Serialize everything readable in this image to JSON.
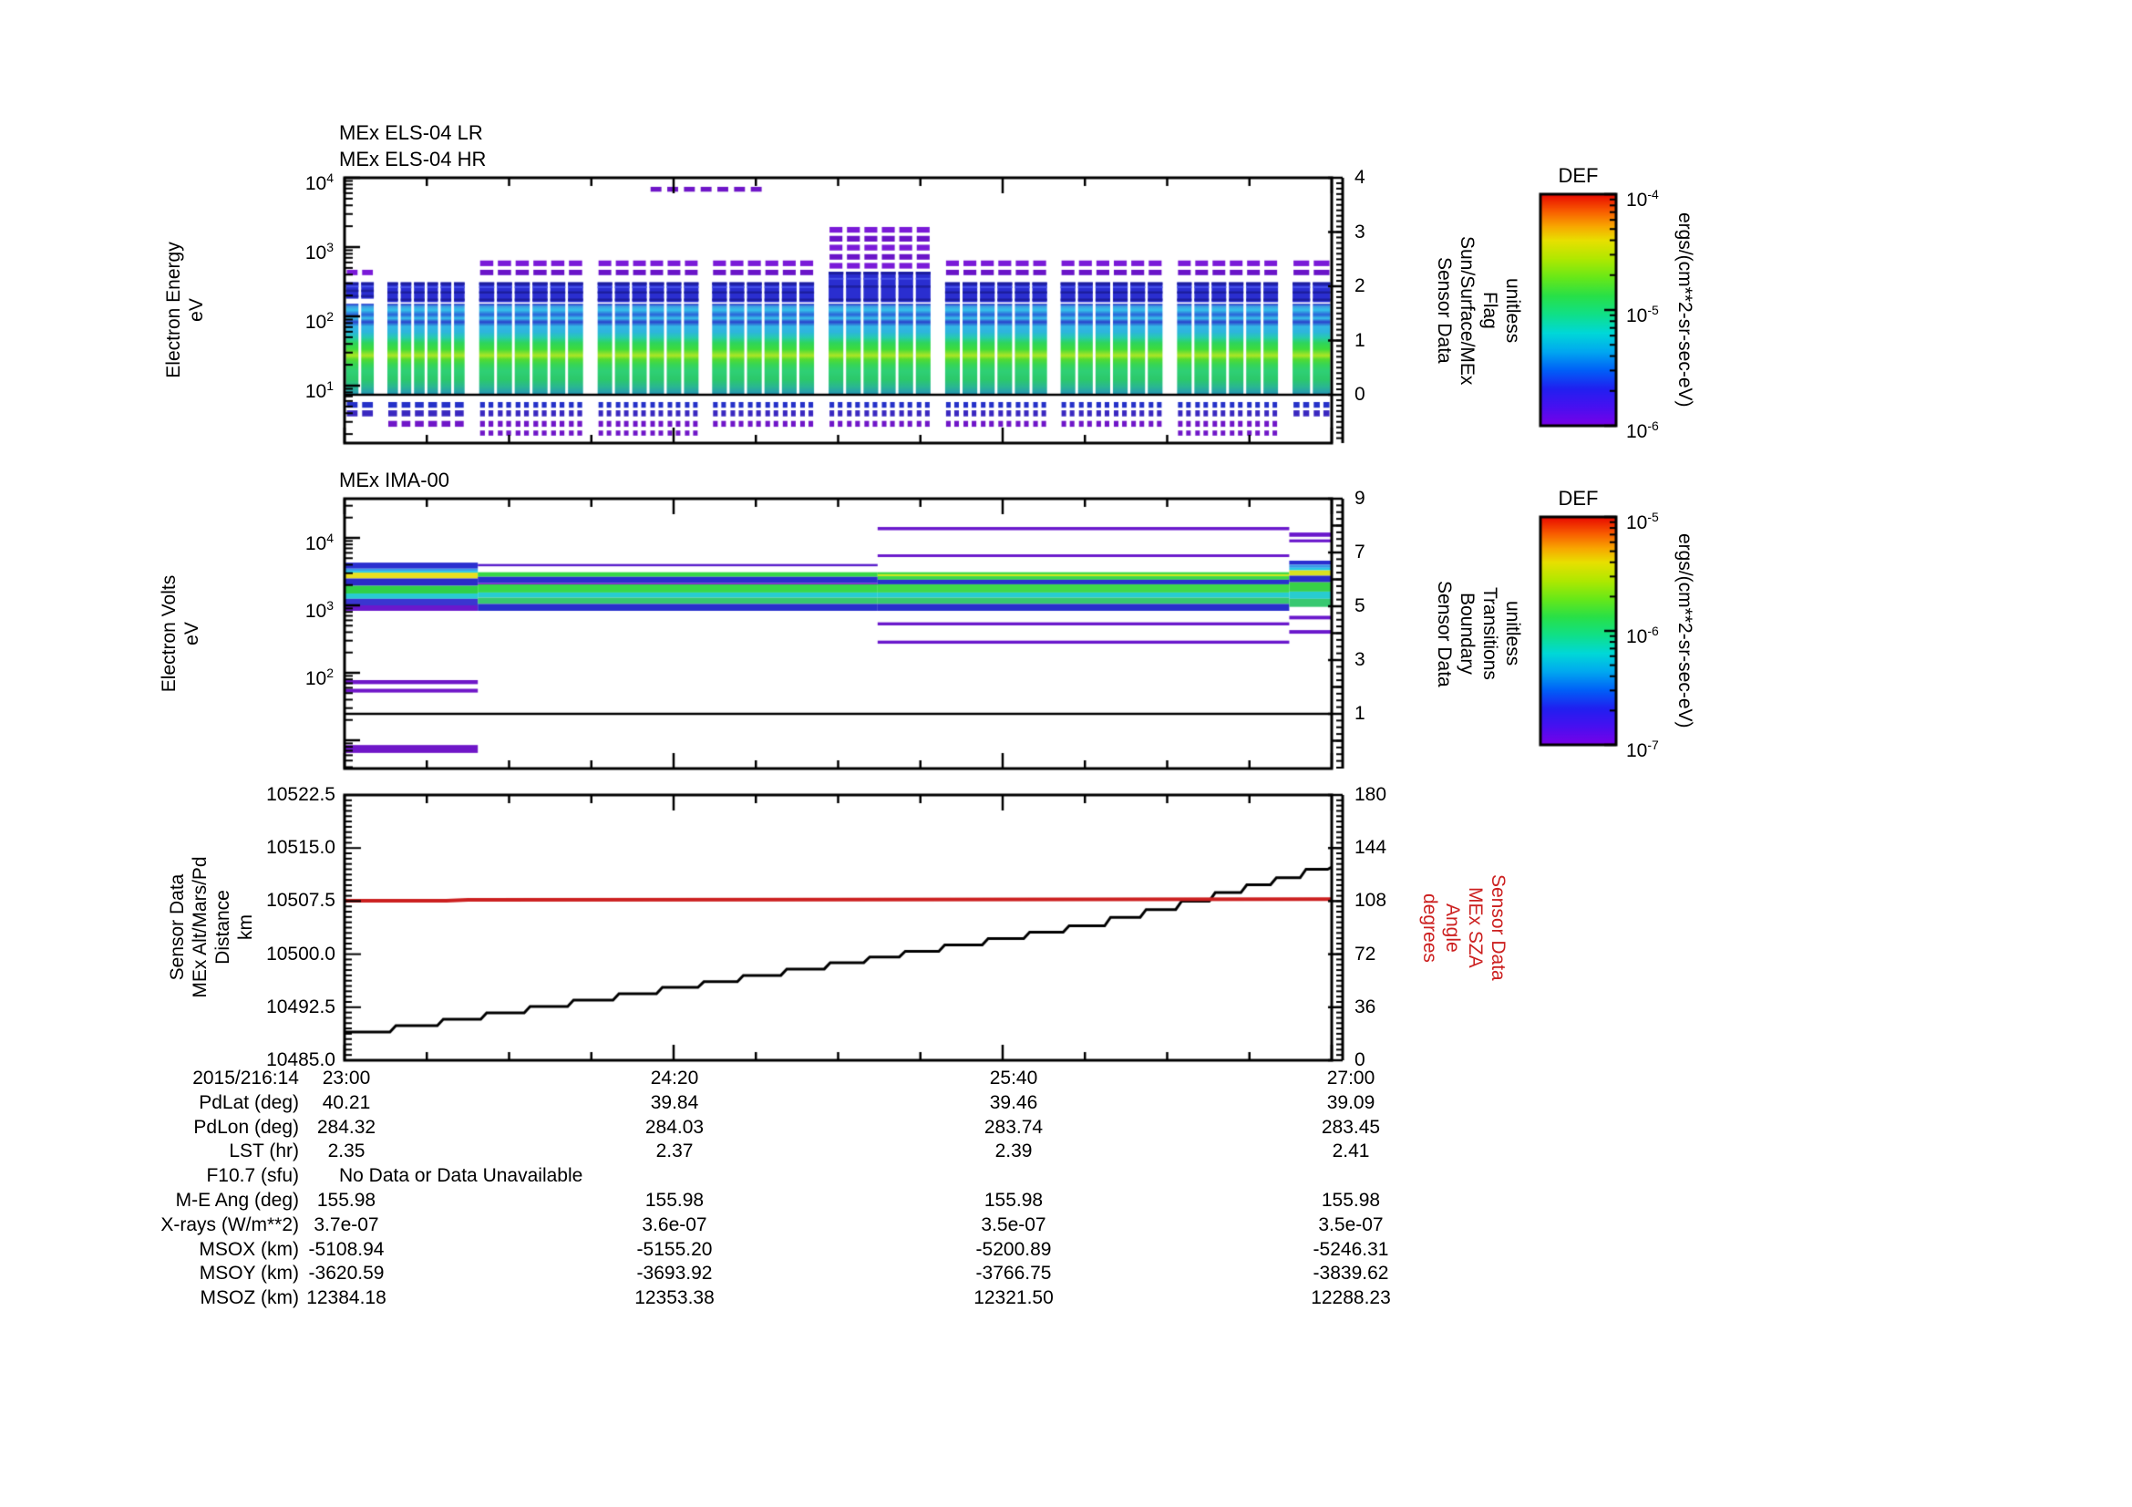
{
  "els_panel": {
    "titles": [
      "MEx ELS-04 LR",
      "MEx ELS-04 HR"
    ],
    "ylabel_lines": [
      "Electron Energy",
      "eV"
    ],
    "ytick_exponents": [
      4,
      3,
      2,
      1
    ],
    "right_label_lines": [
      "Sensor Data",
      "Sun/Surface/MEx",
      "Flag",
      "unitless"
    ],
    "right_ticks": [
      4,
      3,
      2,
      1,
      0
    ]
  },
  "ima_panel": {
    "title": "MEx IMA-00",
    "ylabel_lines": [
      "Electron Volts",
      "eV"
    ],
    "ytick_exponents": [
      4,
      3,
      2
    ],
    "right_label_lines": [
      "Sensor Data",
      "Boundary",
      "Transitions",
      "unitless"
    ],
    "right_ticks": [
      9,
      7,
      5,
      3,
      1
    ]
  },
  "xy_panel": {
    "ylabel_lines": [
      "Sensor Data",
      "MEx Alt/Mars/Pd",
      "Distance",
      "km"
    ],
    "yticks": [
      "10522.5",
      "10515.0",
      "10507.5",
      "10500.0",
      "10492.5",
      "10485.0"
    ],
    "right_label_lines": [
      "Sensor Data",
      "MEx SZA",
      "Angle",
      "degrees"
    ],
    "right_ticks": [
      180,
      144,
      108,
      72,
      36,
      0
    ],
    "xticks": [
      "23:00",
      "24:20",
      "25:40",
      "27:00"
    ],
    "sza_color": "#cc2020",
    "distance_color": "#000000"
  },
  "colorbars": [
    {
      "title": "DEF",
      "tick_exponents": [
        -4,
        -5,
        -6
      ],
      "unit": "ergs/(cm**2-sr-sec-eV)"
    },
    {
      "title": "DEF",
      "tick_exponents": [
        -5,
        -6,
        -7
      ],
      "unit": "ergs/(cm**2-sr-sec-eV)"
    }
  ],
  "table": {
    "date_label": "2015/216:14",
    "row_labels": [
      "PdLat (deg)",
      "PdLon (deg)",
      "LST (hr)",
      "F10.7 (sfu)",
      "M-E Ang (deg)",
      "X-rays (W/m**2)",
      "MSOX (km)",
      "MSOY (km)",
      "MSOZ (km)"
    ],
    "no_data_text": "No Data or Data Unavailable",
    "columns": [
      {
        "time": "23:00",
        "values": [
          "40.21",
          "284.32",
          "2.35",
          "",
          "155.98",
          "3.7e-07",
          "-5108.94",
          "-3620.59",
          "12384.18"
        ]
      },
      {
        "time": "24:20",
        "values": [
          "39.84",
          "284.03",
          "2.37",
          "",
          "155.98",
          "3.6e-07",
          "-5155.20",
          "-3693.92",
          "12353.38"
        ]
      },
      {
        "time": "25:40",
        "values": [
          "39.46",
          "283.74",
          "2.39",
          "",
          "155.98",
          "3.5e-07",
          "-5200.89",
          "-3766.75",
          "12321.50"
        ]
      },
      {
        "time": "27:00",
        "values": [
          "39.09",
          "283.45",
          "2.41",
          "",
          "155.98",
          "3.5e-07",
          "-5246.31",
          "-3839.62",
          "12288.23"
        ]
      }
    ]
  },
  "chart_data": [
    {
      "id": "els",
      "type": "heatmap",
      "title": "MEx ELS-04 LR / MEx ELS-04 HR",
      "x_range": [
        "23:00",
        "27:00"
      ],
      "y_range_ev": [
        1.5,
        10000
      ],
      "value_range": [
        "1e-6",
        "1e-4"
      ],
      "flag_line_value": 0,
      "band_energy_ev": [
        152,
        7.4
      ],
      "band_gradient": [
        [
          0.0,
          "#2433c8"
        ],
        [
          0.03,
          "#3f9fe3"
        ],
        [
          0.07,
          "#35c3ea"
        ],
        [
          0.12,
          "#2a62d8"
        ],
        [
          0.16,
          "#38c3ea"
        ],
        [
          0.2,
          "#2a42cc"
        ],
        [
          0.25,
          "#34b8e6"
        ],
        [
          0.31,
          "#2db4dd"
        ],
        [
          0.37,
          "#27cbb0"
        ],
        [
          0.43,
          "#2ed55e"
        ],
        [
          0.5,
          "#3fdc3a"
        ],
        [
          0.57,
          "#aee625"
        ],
        [
          0.61,
          "#55dc30"
        ],
        [
          0.67,
          "#36d556"
        ],
        [
          0.74,
          "#2fd076"
        ],
        [
          0.83,
          "#2cc96a"
        ],
        [
          0.91,
          "#2ab890"
        ],
        [
          1.0,
          "#2796b8"
        ]
      ],
      "below_line_rows": [
        [
          5.8,
          4.8,
          "#2531c8"
        ],
        [
          4.4,
          3.6,
          "#3a28c0"
        ],
        [
          3.1,
          2.55,
          "#6f16c8"
        ],
        [
          2.25,
          1.9,
          "#6f16c8"
        ]
      ],
      "high_dash": {
        "x0": 0.31,
        "x1": 0.42,
        "e_hi": 7400,
        "e_lo": 6300,
        "color": "#6f16c8"
      },
      "colors": {
        "purple": "#7a1ad8",
        "blue_block": "#2a2ed0",
        "blue_dark": "#1d1fa0",
        "blue_lite": "#4550e8"
      },
      "groups": [
        {
          "x0": 0.0,
          "x1": 0.031,
          "cols": 2,
          "purple": [
            [
              470,
              370
            ]
          ],
          "blue": [
            310,
            180
          ],
          "band": true,
          "below": 2
        },
        {
          "x0": 0.042,
          "x1": 0.123,
          "cols": 6,
          "purple": [],
          "blue": [
            310,
            160
          ],
          "band": true,
          "below": 3
        },
        {
          "x0": 0.135,
          "x1": 0.243,
          "cols": 6,
          "purple": [
            [
              640,
              500
            ],
            [
              470,
              370
            ]
          ],
          "blue": [
            310,
            160
          ],
          "band": true,
          "below": 4
        },
        {
          "x0": 0.255,
          "x1": 0.36,
          "cols": 6,
          "purple": [
            [
              640,
              500
            ],
            [
              470,
              370
            ]
          ],
          "blue": [
            310,
            160
          ],
          "band": true,
          "below": 4
        },
        {
          "x0": 0.371,
          "x1": 0.477,
          "cols": 6,
          "purple": [
            [
              640,
              500
            ],
            [
              470,
              370
            ]
          ],
          "blue": [
            310,
            160
          ],
          "band": true,
          "below": 3
        },
        {
          "x0": 0.489,
          "x1": 0.595,
          "cols": 6,
          "purple": [
            [
              1950,
              1520
            ],
            [
              1450,
              1130
            ],
            [
              1080,
              840
            ],
            [
              790,
              620
            ],
            [
              590,
              460
            ]
          ],
          "blue": [
            440,
            160
          ],
          "band": true,
          "below": 3
        },
        {
          "x0": 0.607,
          "x1": 0.713,
          "cols": 6,
          "purple": [
            [
              640,
              500
            ],
            [
              470,
              370
            ]
          ],
          "blue": [
            310,
            160
          ],
          "band": true,
          "below": 3
        },
        {
          "x0": 0.724,
          "x1": 0.83,
          "cols": 6,
          "purple": [
            [
              640,
              500
            ],
            [
              470,
              370
            ]
          ],
          "blue": [
            310,
            160
          ],
          "band": true,
          "below": 3
        },
        {
          "x0": 0.842,
          "x1": 0.947,
          "cols": 6,
          "purple": [
            [
              640,
              500
            ],
            [
              470,
              370
            ]
          ],
          "blue": [
            310,
            160
          ],
          "band": true,
          "below": 4
        },
        {
          "x0": 0.959,
          "x1": 1.0,
          "cols": 2,
          "purple": [
            [
              640,
              500
            ],
            [
              470,
              370
            ]
          ],
          "blue": [
            310,
            160
          ],
          "band": true,
          "below": 2
        }
      ]
    },
    {
      "id": "ima",
      "type": "heatmap",
      "title": "MEx IMA-00",
      "x_range": [
        "23:00",
        "27:00"
      ],
      "y_range_ev": [
        4,
        38000
      ],
      "value_range": [
        "1e-7",
        "1e-5"
      ],
      "boundary_line_value": 1,
      "segments": [
        {
          "x0": 0.0,
          "x1": 0.135,
          "bands": [
            [
              4300,
              3500,
              "#2b2fd0"
            ],
            [
              3500,
              3250,
              "#3a9ae8"
            ],
            [
              3250,
              3050,
              "#28c8e8"
            ],
            [
              3050,
              2500,
              "#e8e020"
            ],
            [
              2500,
              1950,
              "#2b2bc8"
            ],
            [
              1950,
              1500,
              "#30d048"
            ],
            [
              1500,
              1250,
              "#28ccd0"
            ],
            [
              1250,
              1000,
              "#3a35d0"
            ],
            [
              1000,
              830,
              "#6a18cc"
            ],
            [
              78,
              68,
              "#6f16c8"
            ],
            [
              58,
              51,
              "#6f16c8"
            ],
            [
              8.5,
              6.5,
              "#6f16c8"
            ]
          ]
        },
        {
          "x0": 0.135,
          "x1": 0.54,
          "bands": [
            [
              4100,
              3850,
              "#5a20cc"
            ],
            [
              3100,
              2650,
              "#38d848"
            ],
            [
              2650,
              2150,
              "#2830cc"
            ],
            [
              2150,
              2040,
              "#7020cc"
            ],
            [
              2040,
              1550,
              "#38d848"
            ],
            [
              1550,
              1300,
              "#28ccd0"
            ],
            [
              1300,
              1050,
              "#38c870"
            ],
            [
              1050,
              830,
              "#2830cc"
            ]
          ]
        },
        {
          "x0": 0.54,
          "x1": 0.957,
          "bands": [
            [
              14500,
              13000,
              "#6a18cc"
            ],
            [
              5700,
              5200,
              "#6a18cc"
            ],
            [
              3100,
              2900,
              "#38d848"
            ],
            [
              2900,
              2700,
              "#c8e822"
            ],
            [
              2700,
              2400,
              "#38d848"
            ],
            [
              2400,
              2050,
              "#2830cc"
            ],
            [
              2050,
              1550,
              "#40d848"
            ],
            [
              1550,
              1300,
              "#28ccd0"
            ],
            [
              1300,
              1050,
              "#38c870"
            ],
            [
              1050,
              830,
              "#2830cc"
            ],
            [
              560,
              505,
              "#6a18cc"
            ],
            [
              300,
              270,
              "#6a18cc"
            ]
          ]
        },
        {
          "x0": 0.957,
          "x1": 1.0,
          "bands": [
            [
              12000,
              10400,
              "#6a18cc"
            ],
            [
              9500,
              8600,
              "#6a18cc"
            ],
            [
              4600,
              4000,
              "#2b2fd0"
            ],
            [
              4000,
              3600,
              "#3a9ae8"
            ],
            [
              3600,
              3300,
              "#28c8e8"
            ],
            [
              3300,
              2750,
              "#d8e020"
            ],
            [
              2750,
              2200,
              "#2b2bc8"
            ],
            [
              2200,
              1600,
              "#38d048"
            ],
            [
              1600,
              1250,
              "#28ccd0"
            ],
            [
              1250,
              950,
              "#38c870"
            ],
            [
              700,
              620,
              "#6a18cc"
            ],
            [
              430,
              380,
              "#6a18cc"
            ]
          ]
        }
      ]
    },
    {
      "id": "xy",
      "type": "line",
      "x_tick_labels": [
        "23:00",
        "24:20",
        "25:40",
        "27:00"
      ],
      "ylim_left_km": [
        10485.0,
        10522.5
      ],
      "ylim_right_deg": [
        0,
        180
      ],
      "series": [
        {
          "name": "MEx Alt/Mars/Pd Distance (km)",
          "color": "#000000",
          "axis": "left",
          "points": [
            [
              0.0,
              10489.0
            ],
            [
              0.046,
              10489.0
            ],
            [
              0.052,
              10489.9
            ],
            [
              0.094,
              10489.9
            ],
            [
              0.1,
              10490.8
            ],
            [
              0.138,
              10490.8
            ],
            [
              0.144,
              10491.7
            ],
            [
              0.182,
              10491.7
            ],
            [
              0.188,
              10492.6
            ],
            [
              0.226,
              10492.6
            ],
            [
              0.232,
              10493.5
            ],
            [
              0.272,
              10493.5
            ],
            [
              0.278,
              10494.4
            ],
            [
              0.316,
              10494.4
            ],
            [
              0.322,
              10495.3
            ],
            [
              0.358,
              10495.3
            ],
            [
              0.364,
              10496.1
            ],
            [
              0.398,
              10496.1
            ],
            [
              0.404,
              10497.0
            ],
            [
              0.442,
              10497.0
            ],
            [
              0.448,
              10497.9
            ],
            [
              0.486,
              10497.9
            ],
            [
              0.492,
              10498.8
            ],
            [
              0.526,
              10498.8
            ],
            [
              0.532,
              10499.6
            ],
            [
              0.562,
              10499.6
            ],
            [
              0.568,
              10500.4
            ],
            [
              0.602,
              10500.4
            ],
            [
              0.608,
              10501.3
            ],
            [
              0.646,
              10501.3
            ],
            [
              0.652,
              10502.2
            ],
            [
              0.688,
              10502.2
            ],
            [
              0.694,
              10503.1
            ],
            [
              0.728,
              10503.1
            ],
            [
              0.734,
              10504.0
            ],
            [
              0.77,
              10504.0
            ],
            [
              0.776,
              10505.2
            ],
            [
              0.806,
              10505.2
            ],
            [
              0.812,
              10506.3
            ],
            [
              0.842,
              10506.3
            ],
            [
              0.848,
              10507.5
            ],
            [
              0.876,
              10507.5
            ],
            [
              0.882,
              10508.7
            ],
            [
              0.908,
              10508.7
            ],
            [
              0.914,
              10509.8
            ],
            [
              0.938,
              10509.8
            ],
            [
              0.944,
              10510.8
            ],
            [
              0.968,
              10510.8
            ],
            [
              0.974,
              10512.0
            ],
            [
              0.996,
              10512.0
            ],
            [
              1.0,
              10512.3
            ]
          ]
        },
        {
          "name": "MEx SZA Angle (degrees)",
          "color": "#cc2020",
          "axis": "right",
          "points": [
            [
              0.0,
              108.3
            ],
            [
              0.103,
              108.3
            ],
            [
              0.125,
              108.9
            ],
            [
              0.5,
              109.0
            ],
            [
              1.0,
              109.4
            ]
          ]
        }
      ]
    }
  ]
}
